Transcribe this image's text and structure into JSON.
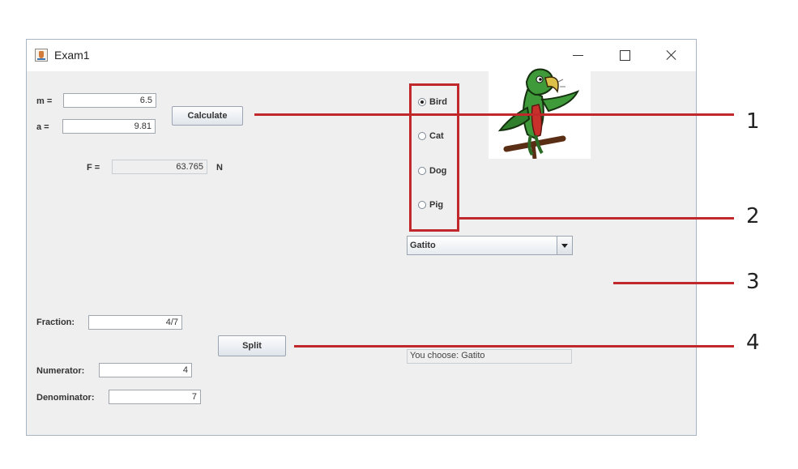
{
  "window": {
    "title": "Exam1"
  },
  "physics": {
    "m_label": "m =",
    "m_value": "6.5",
    "a_label": "a =",
    "a_value": "9.81",
    "calculate_label": "Calculate",
    "f_label": "F =",
    "f_value": "63.765",
    "f_unit": "N"
  },
  "animals": {
    "options": [
      "Bird",
      "Cat",
      "Dog",
      "Pig"
    ],
    "selected": "Bird",
    "image_icon": "parrot-image"
  },
  "combo": {
    "value": "Gatito"
  },
  "result": {
    "text": "You choose: Gatito"
  },
  "fraction": {
    "fraction_label": "Fraction:",
    "fraction_value": "4/7",
    "split_label": "Split",
    "numerator_label": "Numerator:",
    "numerator_value": "4",
    "denominator_label": "Denominator:",
    "denominator_value": "7"
  },
  "annotations": [
    "1",
    "2",
    "3",
    "4"
  ],
  "colors": {
    "annotation": "#c0282c",
    "window_bg": "#efefef"
  }
}
